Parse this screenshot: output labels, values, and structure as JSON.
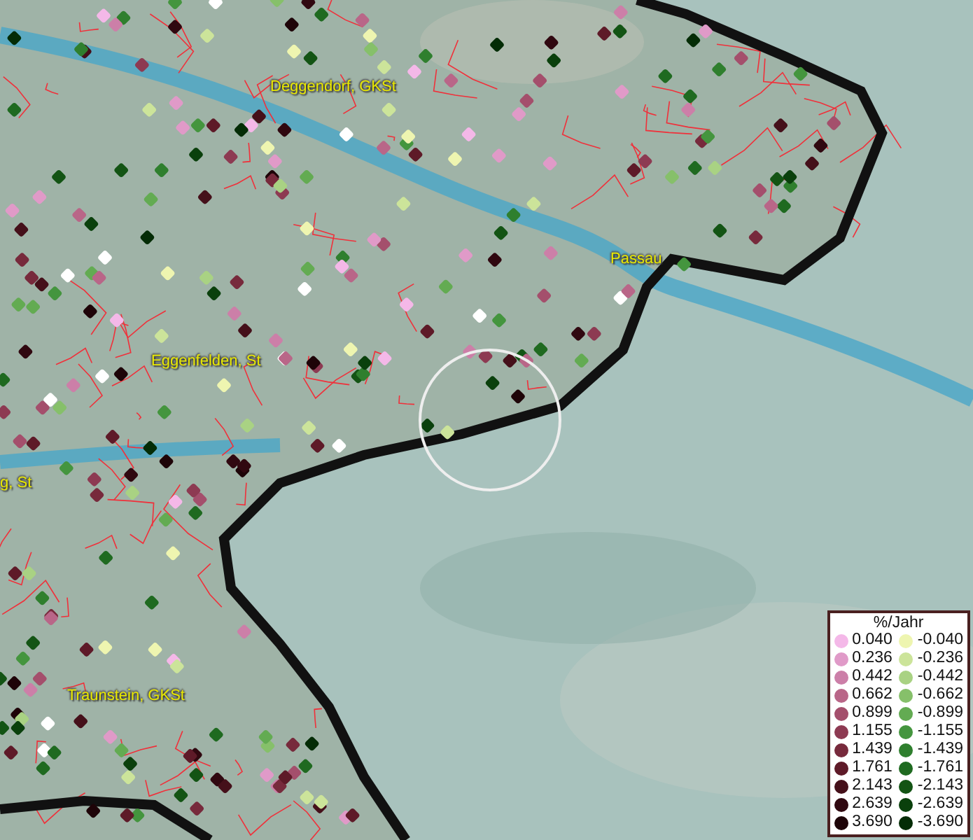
{
  "map": {
    "places": [
      {
        "label": "Deggendorf, GKSt"
      },
      {
        "label": "Eggenfelden, St"
      },
      {
        "label": "Passau"
      },
      {
        "label": "g, St"
      },
      {
        "label": "Traunstein, GKSt"
      }
    ]
  },
  "legend": {
    "title": "%/Jahr",
    "entries": [
      {
        "label": "0.040",
        "color": "#f4b8e8"
      },
      {
        "label": "-0.040",
        "color": "#eef5b0"
      },
      {
        "label": "0.236",
        "color": "#e09ac8"
      },
      {
        "label": "-0.236",
        "color": "#cce49a"
      },
      {
        "label": "0.442",
        "color": "#cc7fa8"
      },
      {
        "label": "-0.442",
        "color": "#a9d283"
      },
      {
        "label": "0.662",
        "color": "#b96688"
      },
      {
        "label": "-0.662",
        "color": "#86c06a"
      },
      {
        "label": "0.899",
        "color": "#a44f6c"
      },
      {
        "label": "-0.899",
        "color": "#63ab52"
      },
      {
        "label": "1.155",
        "color": "#8d3a52"
      },
      {
        "label": "-1.155",
        "color": "#44953e"
      },
      {
        "label": "1.439",
        "color": "#772a3c"
      },
      {
        "label": "-1.439",
        "color": "#2f7f2e"
      },
      {
        "label": "1.761",
        "color": "#5e1a28"
      },
      {
        "label": "-1.761",
        "color": "#1f6a20"
      },
      {
        "label": "2.143",
        "color": "#45101a"
      },
      {
        "label": "-2.143",
        "color": "#135414"
      },
      {
        "label": "2.639",
        "color": "#300810"
      },
      {
        "label": "-2.639",
        "color": "#0a400c"
      },
      {
        "label": "3.690",
        "color": "#1e0408"
      },
      {
        "label": "-3.690",
        "color": "#042c06"
      }
    ]
  }
}
